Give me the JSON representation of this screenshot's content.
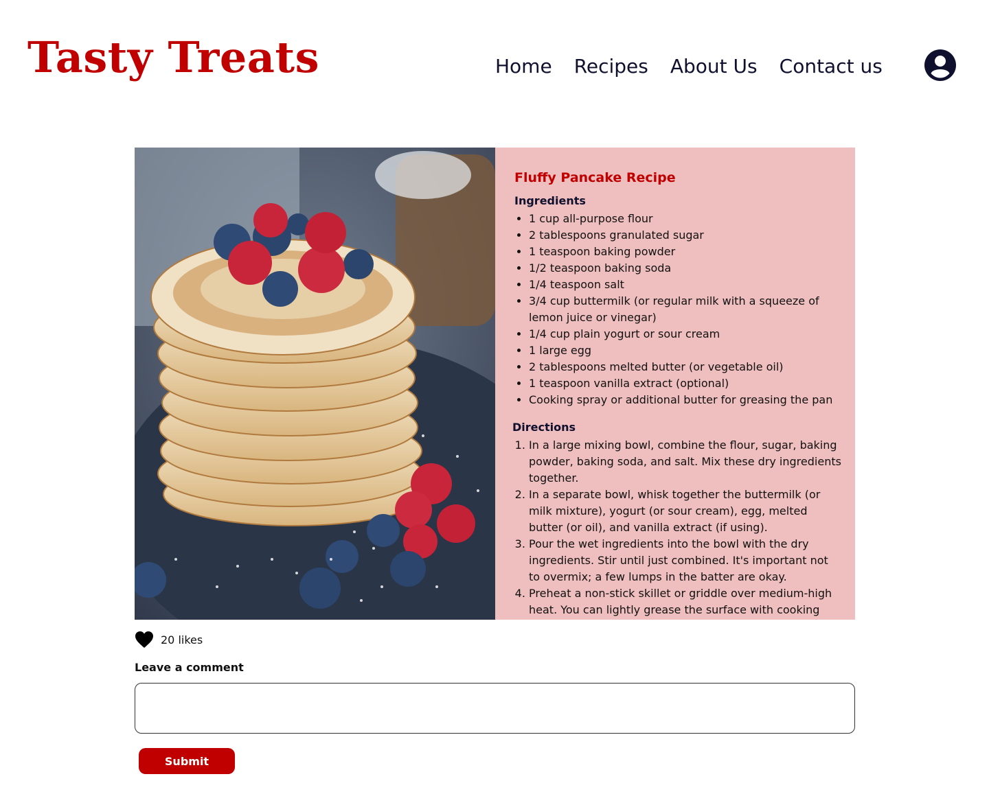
{
  "header": {
    "logo_text": "Tasty Treats",
    "nav": [
      {
        "label": "Home"
      },
      {
        "label": "Recipes"
      },
      {
        "label": "About Us"
      },
      {
        "label": "Contact us"
      }
    ],
    "profile_icon": "user-circle-icon"
  },
  "recipe": {
    "image_subject": "stack of pancakes with blueberries and raspberries",
    "title": "Fluffy Pancake Recipe",
    "ingredients_heading": "Ingredients",
    "ingredients": [
      "1 cup all-purpose flour",
      "2 tablespoons granulated sugar",
      "1 teaspoon baking powder",
      "1/2 teaspoon baking soda",
      "1/4 teaspoon salt",
      "3/4 cup buttermilk (or regular milk with a squeeze of lemon juice or vinegar)",
      "1/4 cup plain yogurt or sour cream",
      "1 large egg",
      "2 tablespoons melted butter (or vegetable oil)",
      "1 teaspoon vanilla extract (optional)",
      "Cooking spray or additional butter for greasing the pan"
    ],
    "directions_heading": "Directions",
    "directions": [
      "In a large mixing bowl, combine the flour, sugar, baking powder, baking soda, and salt. Mix these dry ingredients together.",
      "In a separate bowl, whisk together the buttermilk (or milk mixture), yogurt (or sour cream), egg, melted butter (or oil), and vanilla extract (if using).",
      "Pour the wet ingredients into the bowl with the dry ingredients. Stir until just combined. It's important not to overmix; a few lumps in the batter are okay.",
      "Preheat a non-stick skillet or griddle over medium-high heat. You can lightly grease the surface with cooking"
    ]
  },
  "likes": {
    "icon": "heart-icon",
    "text": "20 likes"
  },
  "comment": {
    "label": "Leave a comment",
    "value": "",
    "placeholder": "",
    "submit_label": "Submit"
  },
  "colors": {
    "brand_red": "#c00000",
    "panel_pink": "#efbebe",
    "nav_text": "#0f0f2e"
  }
}
